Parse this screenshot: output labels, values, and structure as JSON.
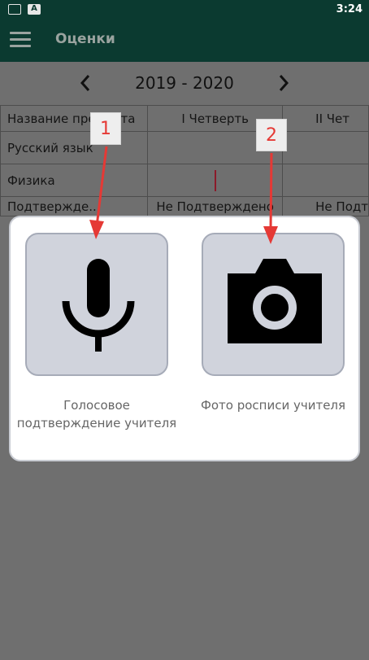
{
  "status_bar": {
    "time": "3:24",
    "notification_icons": [
      "keyboard-icon",
      "a-icon"
    ]
  },
  "app_bar": {
    "title": "Оценки",
    "menu_icon": "hamburger-icon"
  },
  "year_nav": {
    "year": "2019 - 2020",
    "prev": "‹",
    "next": "›"
  },
  "table": {
    "headers": [
      "Название предмета",
      "I Четверть",
      "II Чет"
    ],
    "rows": [
      {
        "subject": "Русский язык",
        "q1": "",
        "q2": ""
      },
      {
        "subject": "Физика",
        "q1": "|",
        "q2": ""
      },
      {
        "subject": "Подтвержде...",
        "q1": "Не Подтверждено",
        "q2": "Не Подт"
      }
    ]
  },
  "dialog": {
    "options": [
      {
        "label": "Голосовое подтверждение учителя",
        "icon": "microphone-icon"
      },
      {
        "label": "Фото росписи учителя",
        "icon": "camera-icon"
      }
    ]
  },
  "annotations": {
    "callout_1": "1",
    "callout_2": "2",
    "arrow_color": "#e53935"
  },
  "colors": {
    "primary_dark": "#0b3a30",
    "dialog_bg": "#ffffff",
    "option_bg": "#d0d3dc",
    "icon": "#000000"
  }
}
